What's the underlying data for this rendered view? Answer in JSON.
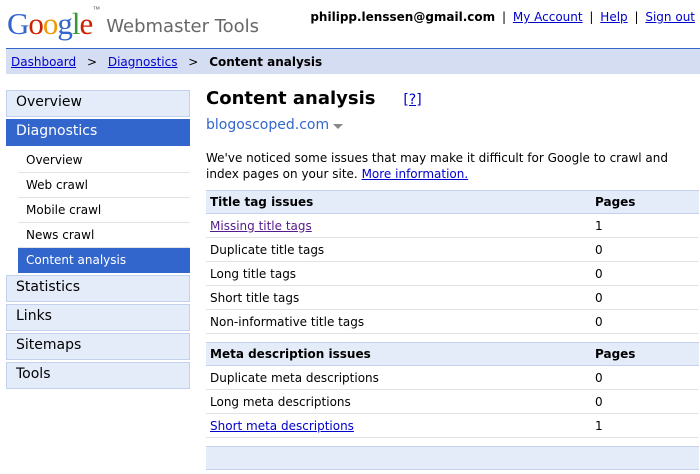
{
  "header": {
    "logo": {
      "letters": [
        "G",
        "o",
        "o",
        "g",
        "l",
        "e"
      ],
      "colors": [
        "#3366cc",
        "#cc2200",
        "#ee9900",
        "#3366cc",
        "#339933",
        "#cc2200"
      ],
      "tm": "™",
      "product": "Webmaster Tools"
    },
    "email": "philipp.lenssen@gmail.com",
    "links": {
      "account": "My Account",
      "help": "Help",
      "signout": "Sign out"
    }
  },
  "breadcrumb": {
    "dashboard": "Dashboard",
    "diagnostics": "Diagnostics",
    "current": "Content analysis",
    "separator": ">"
  },
  "sidebar": {
    "overview": "Overview",
    "diagnostics": "Diagnostics",
    "sub": [
      "Overview",
      "Web crawl",
      "Mobile crawl",
      "News crawl",
      "Content analysis"
    ],
    "after": [
      "Statistics",
      "Links",
      "Sitemaps",
      "Tools"
    ]
  },
  "main": {
    "title": "Content analysis",
    "help": "[?]",
    "site": "blogoscoped.com",
    "intro_text": "We've noticed some issues that may make it difficult for Google to crawl and index pages on your site.",
    "intro_link": "More information.",
    "title_table": {
      "header": "Title tag issues",
      "pages_header": "Pages",
      "rows": [
        {
          "label": "Missing title tags",
          "pages": "1"
        },
        {
          "label": "Duplicate title tags",
          "pages": "0"
        },
        {
          "label": "Long title tags",
          "pages": "0"
        },
        {
          "label": "Short title tags",
          "pages": "0"
        },
        {
          "label": "Non-informative title tags",
          "pages": "0"
        }
      ]
    },
    "meta_table": {
      "header": "Meta description issues",
      "pages_header": "Pages",
      "rows": [
        {
          "label": "Duplicate meta descriptions",
          "pages": "0"
        },
        {
          "label": "Long meta descriptions",
          "pages": "0"
        },
        {
          "label": "Short meta descriptions",
          "pages": "1"
        }
      ]
    }
  }
}
